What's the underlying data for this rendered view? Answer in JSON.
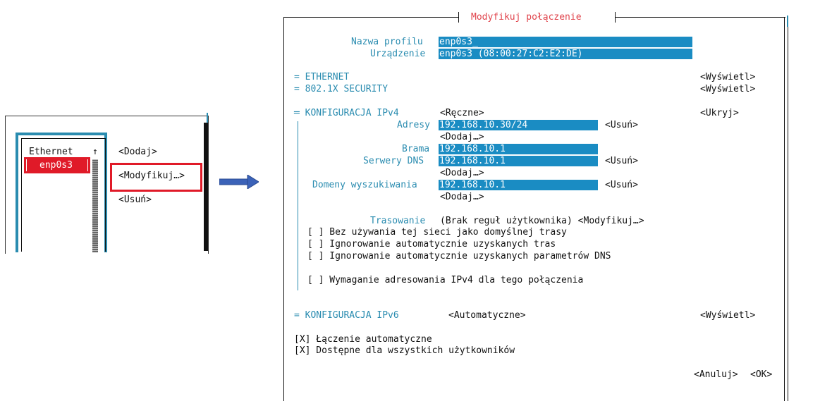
{
  "small_dialog": {
    "list_header": "Ethernet",
    "list_header_arrow": "↑",
    "selected_item": "enp0s3",
    "add_button": "<Dodaj>",
    "modify_button": "<Modyfikuj…>",
    "delete_button": "<Usuń>"
  },
  "dialog": {
    "title": "Modyfikuj połączenie",
    "profile_name_label": "Nazwa profilu",
    "profile_name_value": "enp0s3_",
    "device_label": "Urządzenie",
    "device_value": "enp0s3 (08:00:27:C2:E2:DE)",
    "ethernet_label": "= ETHERNET",
    "ethernet_toggle": "<Wyświetl>",
    "security_label": "= 802.1X SECURITY",
    "security_toggle": "<Wyświetl>",
    "ipv4": {
      "label": "═ KONFIGURACJA IPv4",
      "mode": "<Ręczne>",
      "toggle": "<Ukryj>",
      "addresses_label": "Adresy",
      "address_value": "192.168.10.30/24",
      "remove_label": "<Usuń>",
      "add_label": "<Dodaj…>",
      "gateway_label": "Brama",
      "gateway_value": "192.168.10.1",
      "dns_label": "Serwery DNS",
      "dns_value": "192.168.10.1",
      "search_label": "Domeny wyszukiwania",
      "search_value": "192.168.10.1",
      "routing_label": "Trasowanie",
      "routing_value": "(Brak reguł użytkownika) <Modyfikuj…>",
      "check_default_route": "[ ] Bez używania tej sieci jako domyślnej trasy",
      "check_ignore_routes": "[ ] Ignorowanie automatycznie uzyskanych tras",
      "check_ignore_dns": "[ ] Ignorowanie automatycznie uzyskanych parametrów DNS",
      "check_require_ipv4": "[ ] Wymaganie adresowania IPv4 dla tego połączenia"
    },
    "ipv6": {
      "label": "= KONFIGURACJA IPv6",
      "mode": "<Automatyczne>",
      "toggle": "<Wyświetl>"
    },
    "auto_connect": "[X] Łączenie automatyczne",
    "all_users": "[X] Dostępne dla wszystkich użytkowników",
    "cancel_button": "<Anuluj>",
    "ok_button": "<OK>"
  },
  "colors": {
    "field_bg": "#1a8cc3",
    "accent_cyan": "#2a8cb0",
    "highlight_red": "#e01a28"
  }
}
